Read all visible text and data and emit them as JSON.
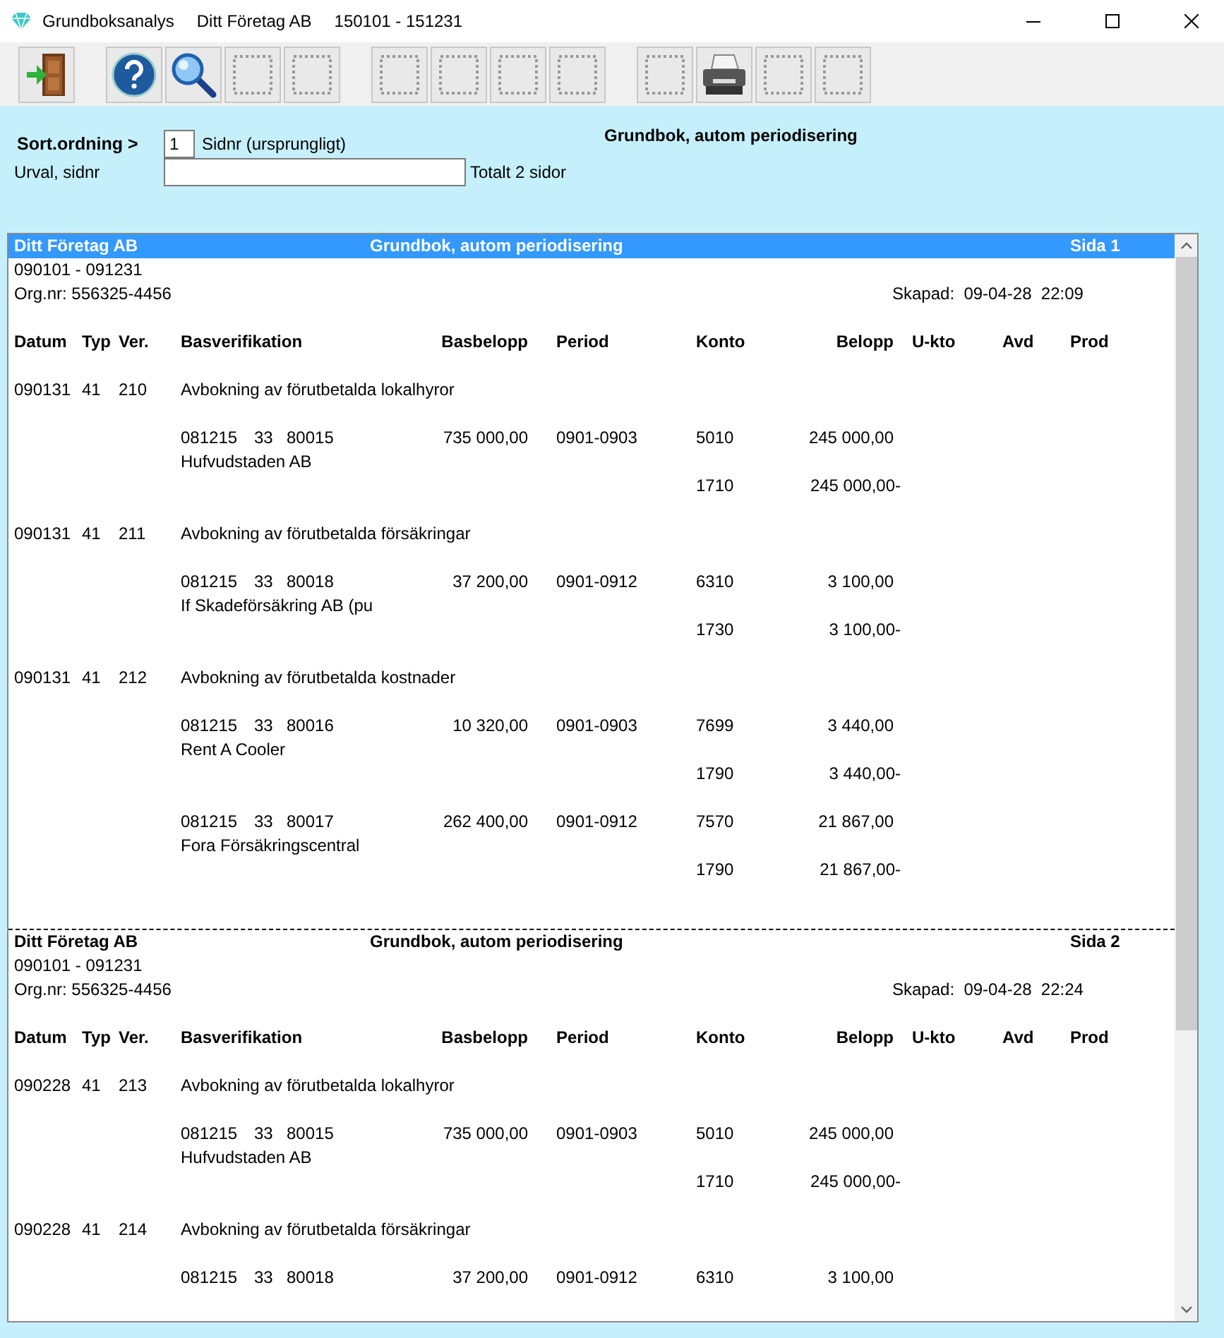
{
  "window": {
    "title_parts": [
      "Grundboksanalys",
      "Ditt Företag AB",
      "150101 - 151231"
    ]
  },
  "toolbar": {
    "groups": [
      {
        "buttons": [
          {
            "kind": "exit"
          }
        ]
      },
      {
        "buttons": [
          {
            "kind": "help"
          },
          {
            "kind": "search"
          },
          {
            "kind": "empty"
          },
          {
            "kind": "empty"
          }
        ]
      },
      {
        "buttons": [
          {
            "kind": "empty"
          },
          {
            "kind": "empty"
          },
          {
            "kind": "empty"
          },
          {
            "kind": "empty"
          }
        ]
      },
      {
        "buttons": [
          {
            "kind": "empty"
          },
          {
            "kind": "printer"
          },
          {
            "kind": "empty"
          },
          {
            "kind": "empty"
          }
        ]
      }
    ]
  },
  "form": {
    "sort_label": "Sort.ordning >",
    "sort_value": "1",
    "sort_text": "Sidnr (ursprungligt)",
    "report_title": "Grundbok, autom periodisering",
    "selection_label": "Urval, sidnr",
    "total_text": "Totalt 2 sidor"
  },
  "report": {
    "pages": [
      {
        "selected": true,
        "company": "Ditt Företag AB",
        "title": "Grundbok, autom periodisering",
        "page_label": "Sida 1",
        "period": "090101 - 091231",
        "orgnr": "Org.nr: 556325-4456",
        "created": "Skapad:  09-04-28  22:09",
        "columns": [
          "Datum",
          "Typ",
          "Ver.",
          "Basverifikation",
          "Basbelopp",
          "Period",
          "Konto",
          "Belopp",
          "U-kto",
          "Avd",
          "Prod"
        ],
        "entries": [
          {
            "date": "090131",
            "type": "41",
            "ver": "210",
            "text": "Avbokning av förutbetalda lokalhyror",
            "postings": [
              {
                "kind": "detail",
                "bas_date": "081215",
                "bas_type": "33",
                "bas_ver": "80015",
                "bas_amount": "735 000,00",
                "period": "0901-0903",
                "account": "5010",
                "amount": "245 000,00",
                "name": "Hufvudstaden AB"
              },
              {
                "kind": "counter",
                "account": "1710",
                "amount": "245 000,00-"
              }
            ]
          },
          {
            "date": "090131",
            "type": "41",
            "ver": "211",
            "text": "Avbokning av förutbetalda försäkringar",
            "postings": [
              {
                "kind": "detail",
                "bas_date": "081215",
                "bas_type": "33",
                "bas_ver": "80018",
                "bas_amount": "37 200,00",
                "period": "0901-0912",
                "account": "6310",
                "amount": "3 100,00",
                "name": "If Skadeförsäkring AB (pu"
              },
              {
                "kind": "counter",
                "account": "1730",
                "amount": "3 100,00-"
              }
            ]
          },
          {
            "date": "090131",
            "type": "41",
            "ver": "212",
            "text": "Avbokning av förutbetalda kostnader",
            "postings": [
              {
                "kind": "detail",
                "bas_date": "081215",
                "bas_type": "33",
                "bas_ver": "80016",
                "bas_amount": "10 320,00",
                "period": "0901-0903",
                "account": "7699",
                "amount": "3 440,00",
                "name": "Rent A Cooler"
              },
              {
                "kind": "counter",
                "account": "1790",
                "amount": "3 440,00-"
              },
              {
                "kind": "detail",
                "bas_date": "081215",
                "bas_type": "33",
                "bas_ver": "80017",
                "bas_amount": "262 400,00",
                "period": "0901-0912",
                "account": "7570",
                "amount": "21 867,00",
                "name": "Fora Försäkringscentral"
              },
              {
                "kind": "counter",
                "account": "1790",
                "amount": "21 867,00-"
              }
            ]
          }
        ]
      },
      {
        "selected": false,
        "company": "Ditt Företag AB",
        "title": "Grundbok, autom periodisering",
        "page_label": "Sida 2",
        "period": "090101 - 091231",
        "orgnr": "Org.nr: 556325-4456",
        "created": "Skapad:  09-04-28  22:24",
        "columns": [
          "Datum",
          "Typ",
          "Ver.",
          "Basverifikation",
          "Basbelopp",
          "Period",
          "Konto",
          "Belopp",
          "U-kto",
          "Avd",
          "Prod"
        ],
        "entries": [
          {
            "date": "090228",
            "type": "41",
            "ver": "213",
            "text": "Avbokning av förutbetalda lokalhyror",
            "postings": [
              {
                "kind": "detail",
                "bas_date": "081215",
                "bas_type": "33",
                "bas_ver": "80015",
                "bas_amount": "735 000,00",
                "period": "0901-0903",
                "account": "5010",
                "amount": "245 000,00",
                "name": "Hufvudstaden AB"
              },
              {
                "kind": "counter",
                "account": "1710",
                "amount": "245 000,00-"
              }
            ]
          },
          {
            "date": "090228",
            "type": "41",
            "ver": "214",
            "text": "Avbokning av förutbetalda försäkringar",
            "postings": [
              {
                "kind": "detail",
                "bas_date": "081215",
                "bas_type": "33",
                "bas_ver": "80018",
                "bas_amount": "37 200,00",
                "period": "0901-0912",
                "account": "6310",
                "amount": "3 100,00"
              }
            ]
          }
        ]
      }
    ]
  }
}
